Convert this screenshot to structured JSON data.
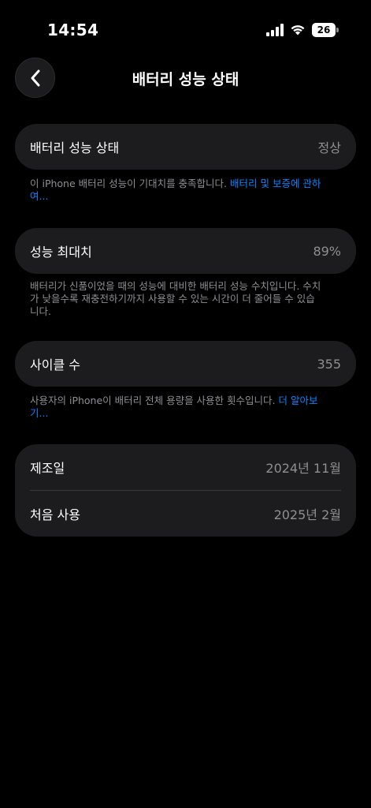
{
  "status_bar": {
    "time": "14:54",
    "battery_level": "26"
  },
  "nav": {
    "title": "배터리 성능 상태",
    "back_icon": "chevron-left-icon"
  },
  "health_card": {
    "label": "배터리 성능 상태",
    "value": "정상"
  },
  "health_note": {
    "text": "이 iPhone 배터리 성능이 기대치를 충족합니다. ",
    "link": "배터리 및 보증에 관하여..."
  },
  "max_capacity_card": {
    "label": "성능 최대치",
    "value": "89%"
  },
  "max_capacity_note": {
    "text": "배터리가 신품이었을 때의 성능에 대비한 배터리 성능 수치입니다. 수치가 낮을수록 재충전하기까지 사용할 수 있는 시간이 더 줄어들 수 있습니다."
  },
  "cycle_card": {
    "label": "사이클 수",
    "value": "355"
  },
  "cycle_note": {
    "text": "사용자의 iPhone이 배터리 전체 용량을 사용한 횟수입니다. ",
    "link": "더 알아보기..."
  },
  "dates_card": {
    "manufacture_label": "제조일",
    "manufacture_value": "2024년 11월",
    "first_use_label": "처음 사용",
    "first_use_value": "2025년 2월"
  },
  "colors": {
    "background": "#000000",
    "card": "#1c1c1e",
    "secondary_text": "#8e8e93",
    "link": "#0a84ff"
  }
}
